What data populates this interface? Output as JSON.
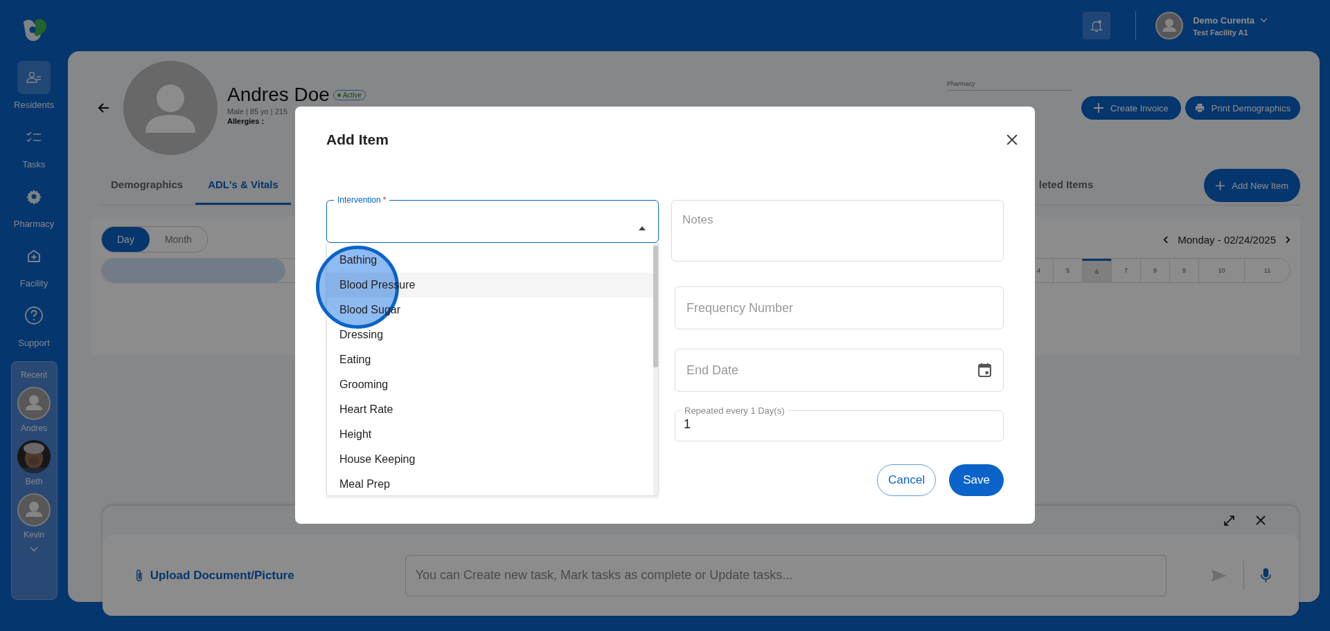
{
  "sidebar": {
    "nav": [
      {
        "label": "Residents",
        "kind": "residents",
        "selected": true
      },
      {
        "label": "Tasks",
        "kind": "tasks",
        "selected": false
      },
      {
        "label": "Pharmacy",
        "kind": "pharmacy",
        "selected": false
      },
      {
        "label": "Facility",
        "kind": "facility",
        "selected": false
      },
      {
        "label": "Support",
        "kind": "support",
        "selected": false
      }
    ],
    "recent": {
      "title": "Recent",
      "people": [
        {
          "name": "Andres",
          "kind": "avatar"
        },
        {
          "name": "Beth",
          "kind": "picture"
        },
        {
          "name": "Kevin",
          "kind": "avatar"
        }
      ]
    }
  },
  "header": {
    "user_name": "Demo Curenta",
    "facility": "Test Facility A1"
  },
  "resident": {
    "name": "Andres Doe",
    "status": "Active",
    "details": "Male | 85 yo | 215",
    "allergies": "Allergies :"
  },
  "pharmacy_label": "Pharmacy",
  "actions": [
    {
      "label": "Create Invoice",
      "kind": "plus"
    },
    {
      "label": "Print Demographics",
      "kind": "print"
    }
  ],
  "tabs": [
    {
      "label": "Demographics",
      "selected": false
    },
    {
      "label": "ADL's & Vitals",
      "selected": true
    },
    {
      "label": "leted Items",
      "selected": false
    }
  ],
  "add_button": "Add New Item",
  "view_toggle": [
    {
      "label": "Day",
      "selected": true
    },
    {
      "label": "Month",
      "selected": false
    }
  ],
  "date": "Monday - 02/24/2025",
  "days": [
    {
      "label": "4",
      "selected": false
    },
    {
      "label": "5",
      "selected": false
    },
    {
      "label": "6",
      "selected": true
    },
    {
      "label": "7",
      "selected": false
    },
    {
      "label": "8",
      "selected": false
    },
    {
      "label": "9",
      "selected": false
    },
    {
      "label": "10",
      "selected": false
    },
    {
      "label": "11",
      "selected": false
    }
  ],
  "modal": {
    "title": "Add Item",
    "intervention": {
      "label": "Intervention",
      "required_mark": "*",
      "expanded": true,
      "options": [
        {
          "label": "Bathing",
          "selected": false
        },
        {
          "label": "Blood Pressure",
          "selected": true
        },
        {
          "label": "Blood Sugar",
          "selected": false
        },
        {
          "label": "Dressing",
          "selected": false
        },
        {
          "label": "Eating",
          "selected": false
        },
        {
          "label": "Grooming",
          "selected": false
        },
        {
          "label": "Heart Rate",
          "selected": false
        },
        {
          "label": "Height",
          "selected": false
        },
        {
          "label": "House Keeping",
          "selected": false
        },
        {
          "label": "Meal Prep",
          "selected": false
        }
      ]
    },
    "notes": {
      "placeholder": "Notes"
    },
    "frequency": {
      "placeholder": "Frequency Number"
    },
    "end_date": {
      "placeholder": "End Date"
    },
    "repeat": {
      "label": "Repeated every 1 Day(s)",
      "value": "1"
    },
    "buttons": [
      {
        "label": "Cancel",
        "kind": "secondary"
      },
      {
        "label": "Save",
        "kind": "primary"
      }
    ]
  },
  "chat": {
    "upload": "Upload Document/Picture",
    "placeholder": "You can Create new task, Mark tasks as complete or Update tasks..."
  }
}
